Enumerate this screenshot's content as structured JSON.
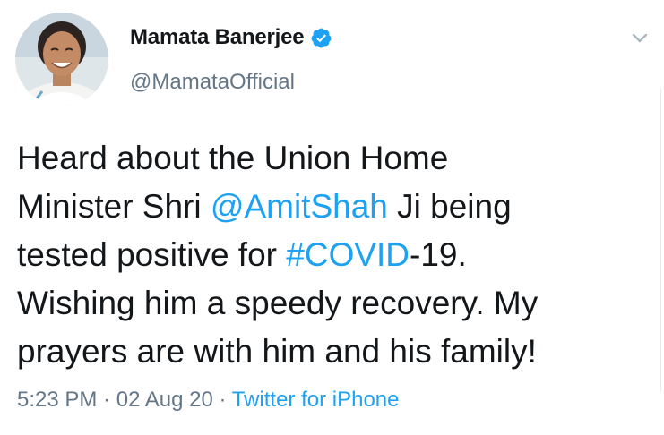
{
  "author": {
    "display_name": "Mamata Banerjee",
    "handle": "@MamataOfficial",
    "verified": true,
    "avatar_icon": "person-avatar"
  },
  "tweet": {
    "lines": [
      {
        "parts": [
          {
            "text": "Heard about the Union Home",
            "type": "text"
          }
        ]
      },
      {
        "parts": [
          {
            "text": "Minister Shri ",
            "type": "text"
          },
          {
            "text": "@AmitShah",
            "type": "mention"
          },
          {
            "text": " Ji being",
            "type": "text"
          }
        ]
      },
      {
        "parts": [
          {
            "text": "tested positive for ",
            "type": "text"
          },
          {
            "text": "#COVID",
            "type": "hashtag"
          },
          {
            "text": "-19.",
            "type": "text"
          }
        ]
      },
      {
        "parts": [
          {
            "text": "Wishing him a speedy recovery. My",
            "type": "text"
          }
        ]
      },
      {
        "parts": [
          {
            "text": "prayers are with him and his family!",
            "type": "text"
          }
        ]
      }
    ]
  },
  "meta": {
    "time": "5:23 PM",
    "separator": " · ",
    "date": "02 Aug 20",
    "source": "Twitter for iPhone"
  },
  "icons": {
    "verified": "verified-badge-icon",
    "menu": "chevron-down-icon"
  },
  "colors": {
    "link": "#1da1f2",
    "secondary_text": "#657786",
    "primary_text": "#14171a",
    "verified_badge": "#1da1f2"
  }
}
